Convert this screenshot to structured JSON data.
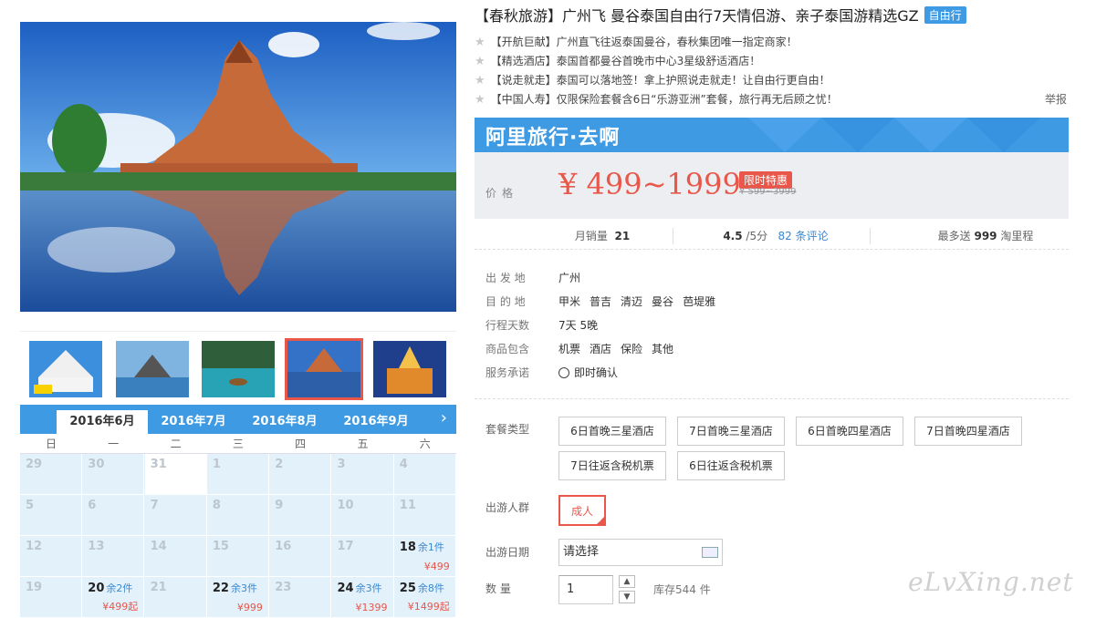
{
  "product": {
    "title": "【春秋旅游】广州飞 曼谷泰国自由行7天情侣游、亲子泰国游精选GZ",
    "tag": "自由行",
    "features": [
      "【开航巨献】广州直飞往返泰国曼谷，春秋集团唯一指定商家！",
      "【精选酒店】泰国首都曼谷首晚市中心3星级舒适酒店！",
      "【说走就走】泰国可以落地签！拿上护照说走就走！让自由行更自由！",
      "【中国人寿】仅限保险套餐含6日“乐游亚洲”套餐，旅行再无后顾之忧！"
    ],
    "report_label": "举报"
  },
  "banner": {
    "brand": "阿里旅行·去啊"
  },
  "price": {
    "label": "价格",
    "value": "¥ 499~1999",
    "promo_badge": "限时特惠",
    "old_price": "¥ 599~3999"
  },
  "stats": {
    "monthly_sales_label": "月销量",
    "monthly_sales": "21",
    "rating": "4.5",
    "rating_suffix": "/5分",
    "review_count": "82",
    "review_label": "条评论",
    "taobao_prefix": "最多送",
    "taobao_miles": "999",
    "taobao_suffix": "淘里程"
  },
  "info": {
    "origin_label": "出 发 地",
    "origin": "广州",
    "dest_label": "目 的 地",
    "destinations": [
      "甲米",
      "普吉",
      "清迈",
      "曼谷",
      "芭堤雅"
    ],
    "duration_label": "行程天数",
    "duration": "7天 5晚",
    "includes_label": "商品包含",
    "includes": [
      "机票",
      "酒店",
      "保险",
      "其他"
    ],
    "service_label": "服务承诺",
    "service": "即时确认"
  },
  "form": {
    "package_label": "套餐类型",
    "packages": [
      "6日首晚三星酒店",
      "7日首晚三星酒店",
      "6日首晚四星酒店",
      "7日首晚四星酒店",
      "7日往返含税机票",
      "6日往返含税机票"
    ],
    "traveler_label": "出游人群",
    "traveler_selected": "成人",
    "date_label": "出游日期",
    "date_placeholder": "请选择",
    "qty_label": "数 量",
    "qty_value": "1",
    "qty_up": "▲",
    "qty_down": "▼",
    "stock_text": "库存544 件"
  },
  "calendar": {
    "tabs": [
      "2016年6月",
      "2016年7月",
      "2016年8月",
      "2016年9月"
    ],
    "next": "›",
    "weekdays": [
      "日",
      "一",
      "二",
      "三",
      "四",
      "五",
      "六"
    ],
    "cells": [
      {
        "d": "29"
      },
      {
        "d": "30"
      },
      {
        "d": "31"
      },
      {
        "d": "1"
      },
      {
        "d": "2"
      },
      {
        "d": "3"
      },
      {
        "d": "4"
      },
      {
        "d": "5"
      },
      {
        "d": "6"
      },
      {
        "d": "7"
      },
      {
        "d": "8"
      },
      {
        "d": "9"
      },
      {
        "d": "10"
      },
      {
        "d": "11"
      },
      {
        "d": "12"
      },
      {
        "d": "13"
      },
      {
        "d": "14"
      },
      {
        "d": "15"
      },
      {
        "d": "16"
      },
      {
        "d": "17"
      },
      {
        "d": "18",
        "stock": "余1件",
        "price": "¥499"
      },
      {
        "d": "19"
      },
      {
        "d": "20",
        "stock": "余2件",
        "price": "¥499起"
      },
      {
        "d": "21"
      },
      {
        "d": "22",
        "stock": "余3件",
        "price": "¥999"
      },
      {
        "d": "23"
      },
      {
        "d": "24",
        "stock": "余3件",
        "price": "¥1399"
      },
      {
        "d": "25",
        "stock": "余8件",
        "price": "¥1499起"
      }
    ]
  },
  "watermark": "eLvXing.net"
}
